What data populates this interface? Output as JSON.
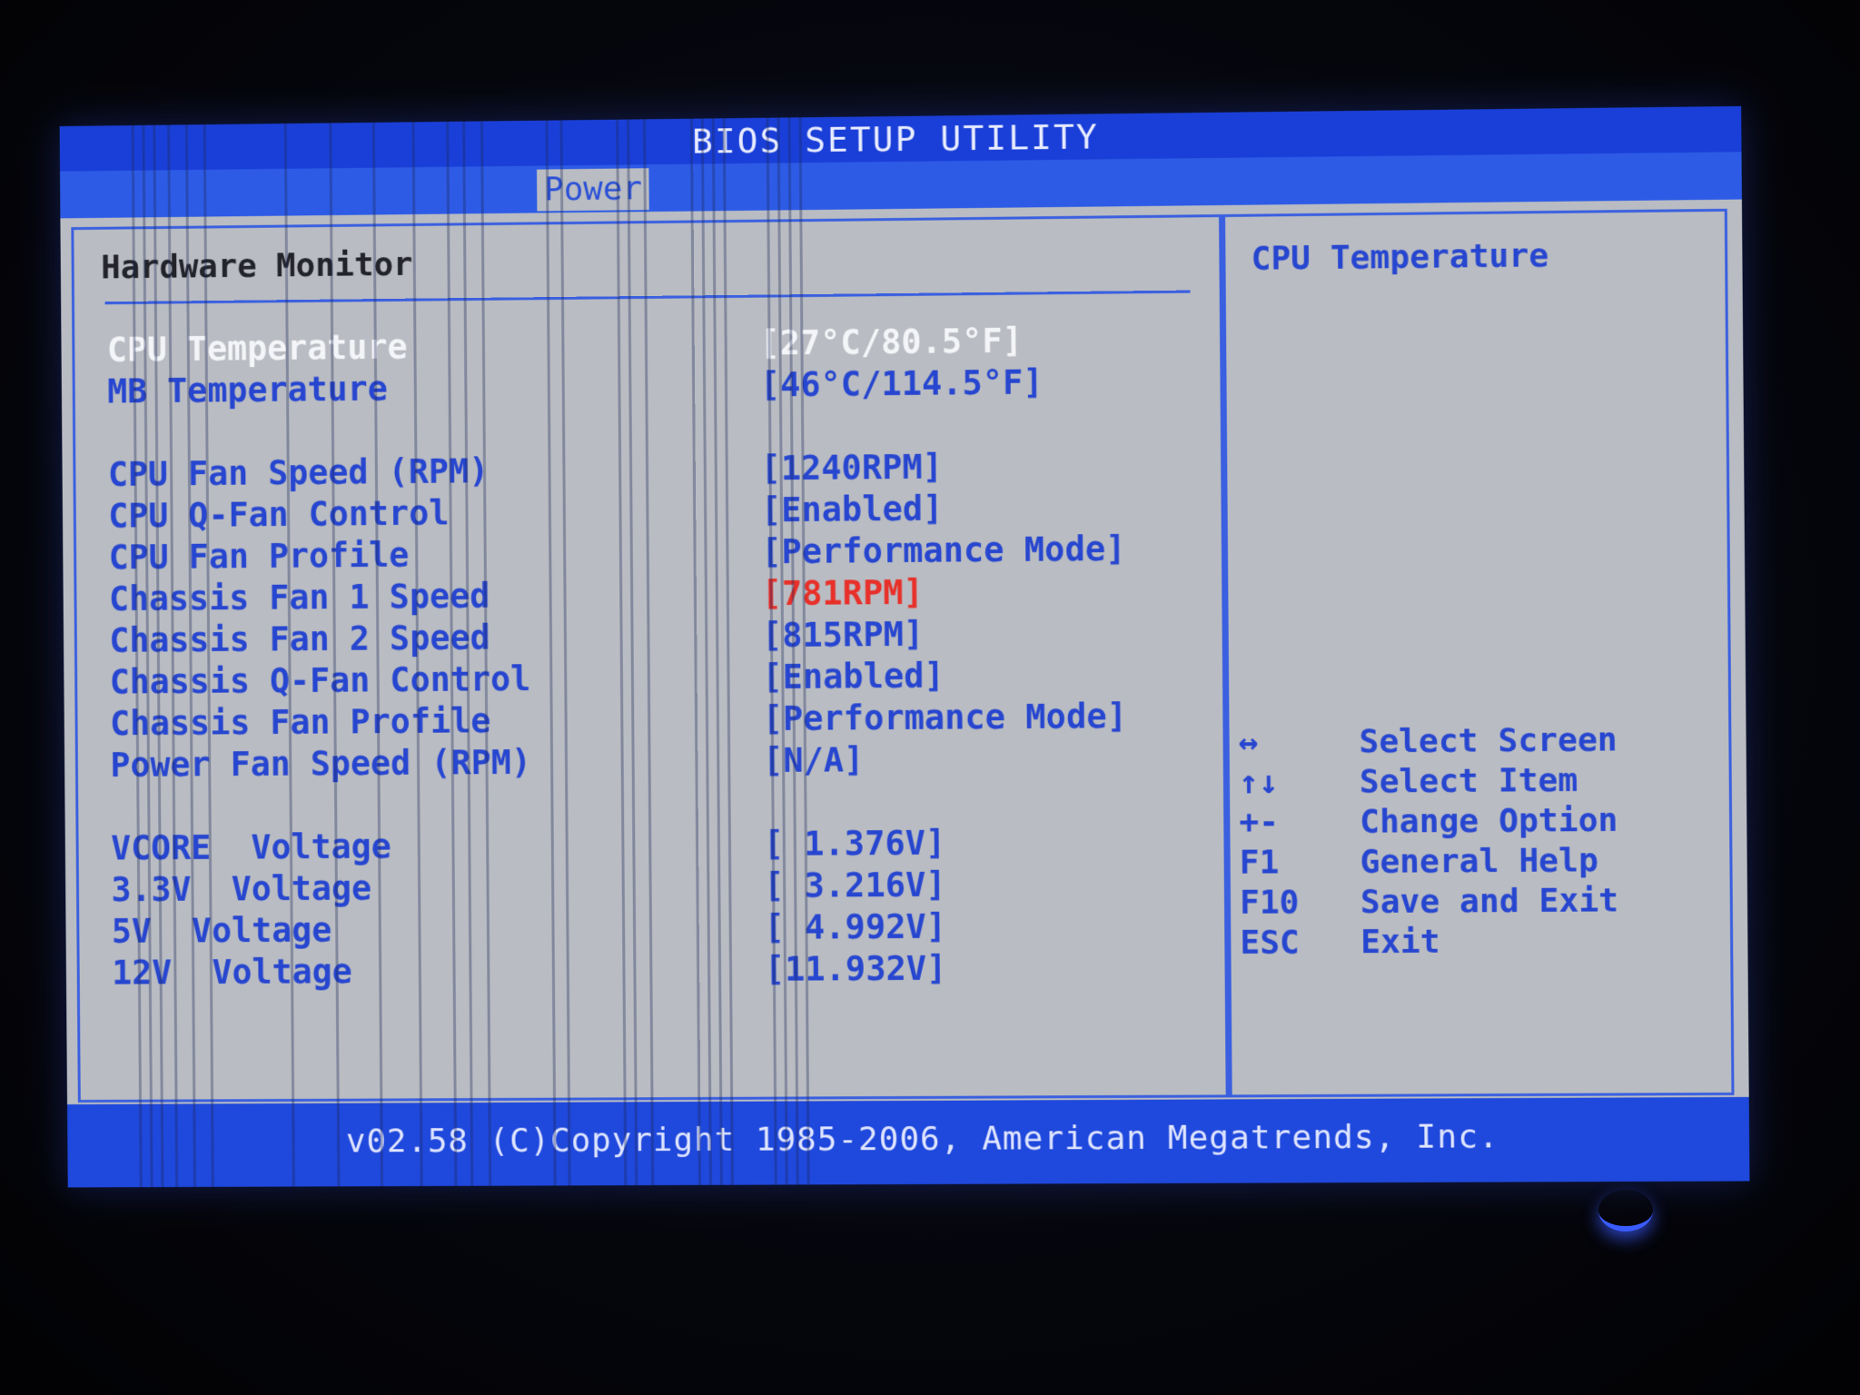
{
  "window": {
    "title": "BIOS SETUP UTILITY"
  },
  "menu": {
    "active_tab": "Power"
  },
  "main": {
    "section_title": "Hardware Monitor",
    "rows": [
      {
        "label": "CPU Temperature",
        "value": "[27°C/80.5°F]"
      },
      {
        "label": "MB Temperature",
        "value": "[46°C/114.5°F]"
      },
      {
        "label": "CPU Fan Speed (RPM)",
        "value": "[1240RPM]"
      },
      {
        "label": "CPU Q-Fan Control",
        "value": "[Enabled]"
      },
      {
        "label": "CPU Fan Profile",
        "value": "[Performance Mode]"
      },
      {
        "label": "Chassis Fan 1 Speed",
        "value": "[781RPM]"
      },
      {
        "label": "Chassis Fan 2 Speed",
        "value": "[815RPM]"
      },
      {
        "label": "Chassis Q-Fan Control",
        "value": "[Enabled]"
      },
      {
        "label": "Chassis Fan Profile",
        "value": "[Performance Mode]"
      },
      {
        "label": "Power Fan Speed (RPM)",
        "value": "[N/A]"
      },
      {
        "label": "VCORE  Voltage",
        "value": "[ 1.376V]"
      },
      {
        "label": "3.3V  Voltage",
        "value": "[ 3.216V]"
      },
      {
        "label": "5V  Voltage",
        "value": "[ 4.992V]"
      },
      {
        "label": "12V  Voltage",
        "value": "[11.932V]"
      }
    ]
  },
  "help": {
    "title": "CPU Temperature",
    "keys": [
      {
        "key": "↔",
        "action": "Select Screen"
      },
      {
        "key": "↑↓",
        "action": "Select Item"
      },
      {
        "key": "+-",
        "action": "Change Option"
      },
      {
        "key": "F1",
        "action": "General Help"
      },
      {
        "key": "F10",
        "action": "Save and Exit"
      },
      {
        "key": "ESC",
        "action": "Exit"
      }
    ]
  },
  "footer": {
    "text": "v02.58 (C)Copyright 1985-2006, American Megatrends, Inc."
  },
  "colors": {
    "title_bar": "#1a3fd8",
    "background": "#b9bcc2",
    "text": "#2746d0",
    "selected_text": "#f4f5f8",
    "warning": "#e8302a"
  }
}
